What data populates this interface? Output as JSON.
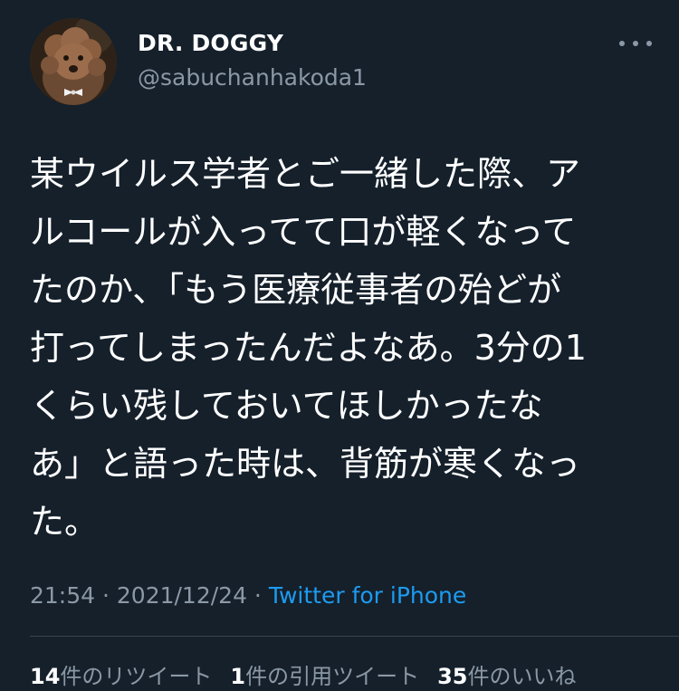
{
  "author": {
    "display_name": "DR. DOGGY",
    "handle": "@sabuchanhakoda1",
    "avatar_icon": "poodle-avatar-icon"
  },
  "more_icon": "more-horizontal-icon",
  "tweet": {
    "lines": [
      "某ウイルス学者とご一緒した際、ア",
      "ルコールが入ってて口が軽くなって",
      "たのか、「もう医療従事者の殆どが",
      "打ってしまったんだよなあ。3分の1",
      "くらい残しておいてほしかったな",
      "あ」と語った時は、背筋が寒くなっ",
      "た。"
    ]
  },
  "meta": {
    "time": "21:54",
    "separator": " · ",
    "date": "2021/12/24",
    "source": "Twitter for iPhone"
  },
  "stats": {
    "retweets_count": "14",
    "retweets_label": "件のリツイート",
    "quotes_count": "1",
    "quotes_label": "件の引用ツイート",
    "likes_count": "35",
    "likes_label": "件のいいね"
  },
  "colors": {
    "background": "#15202b",
    "text_primary": "#ffffff",
    "text_secondary": "#8b98a5",
    "link": "#1d9bf0",
    "divider": "#38444d"
  }
}
